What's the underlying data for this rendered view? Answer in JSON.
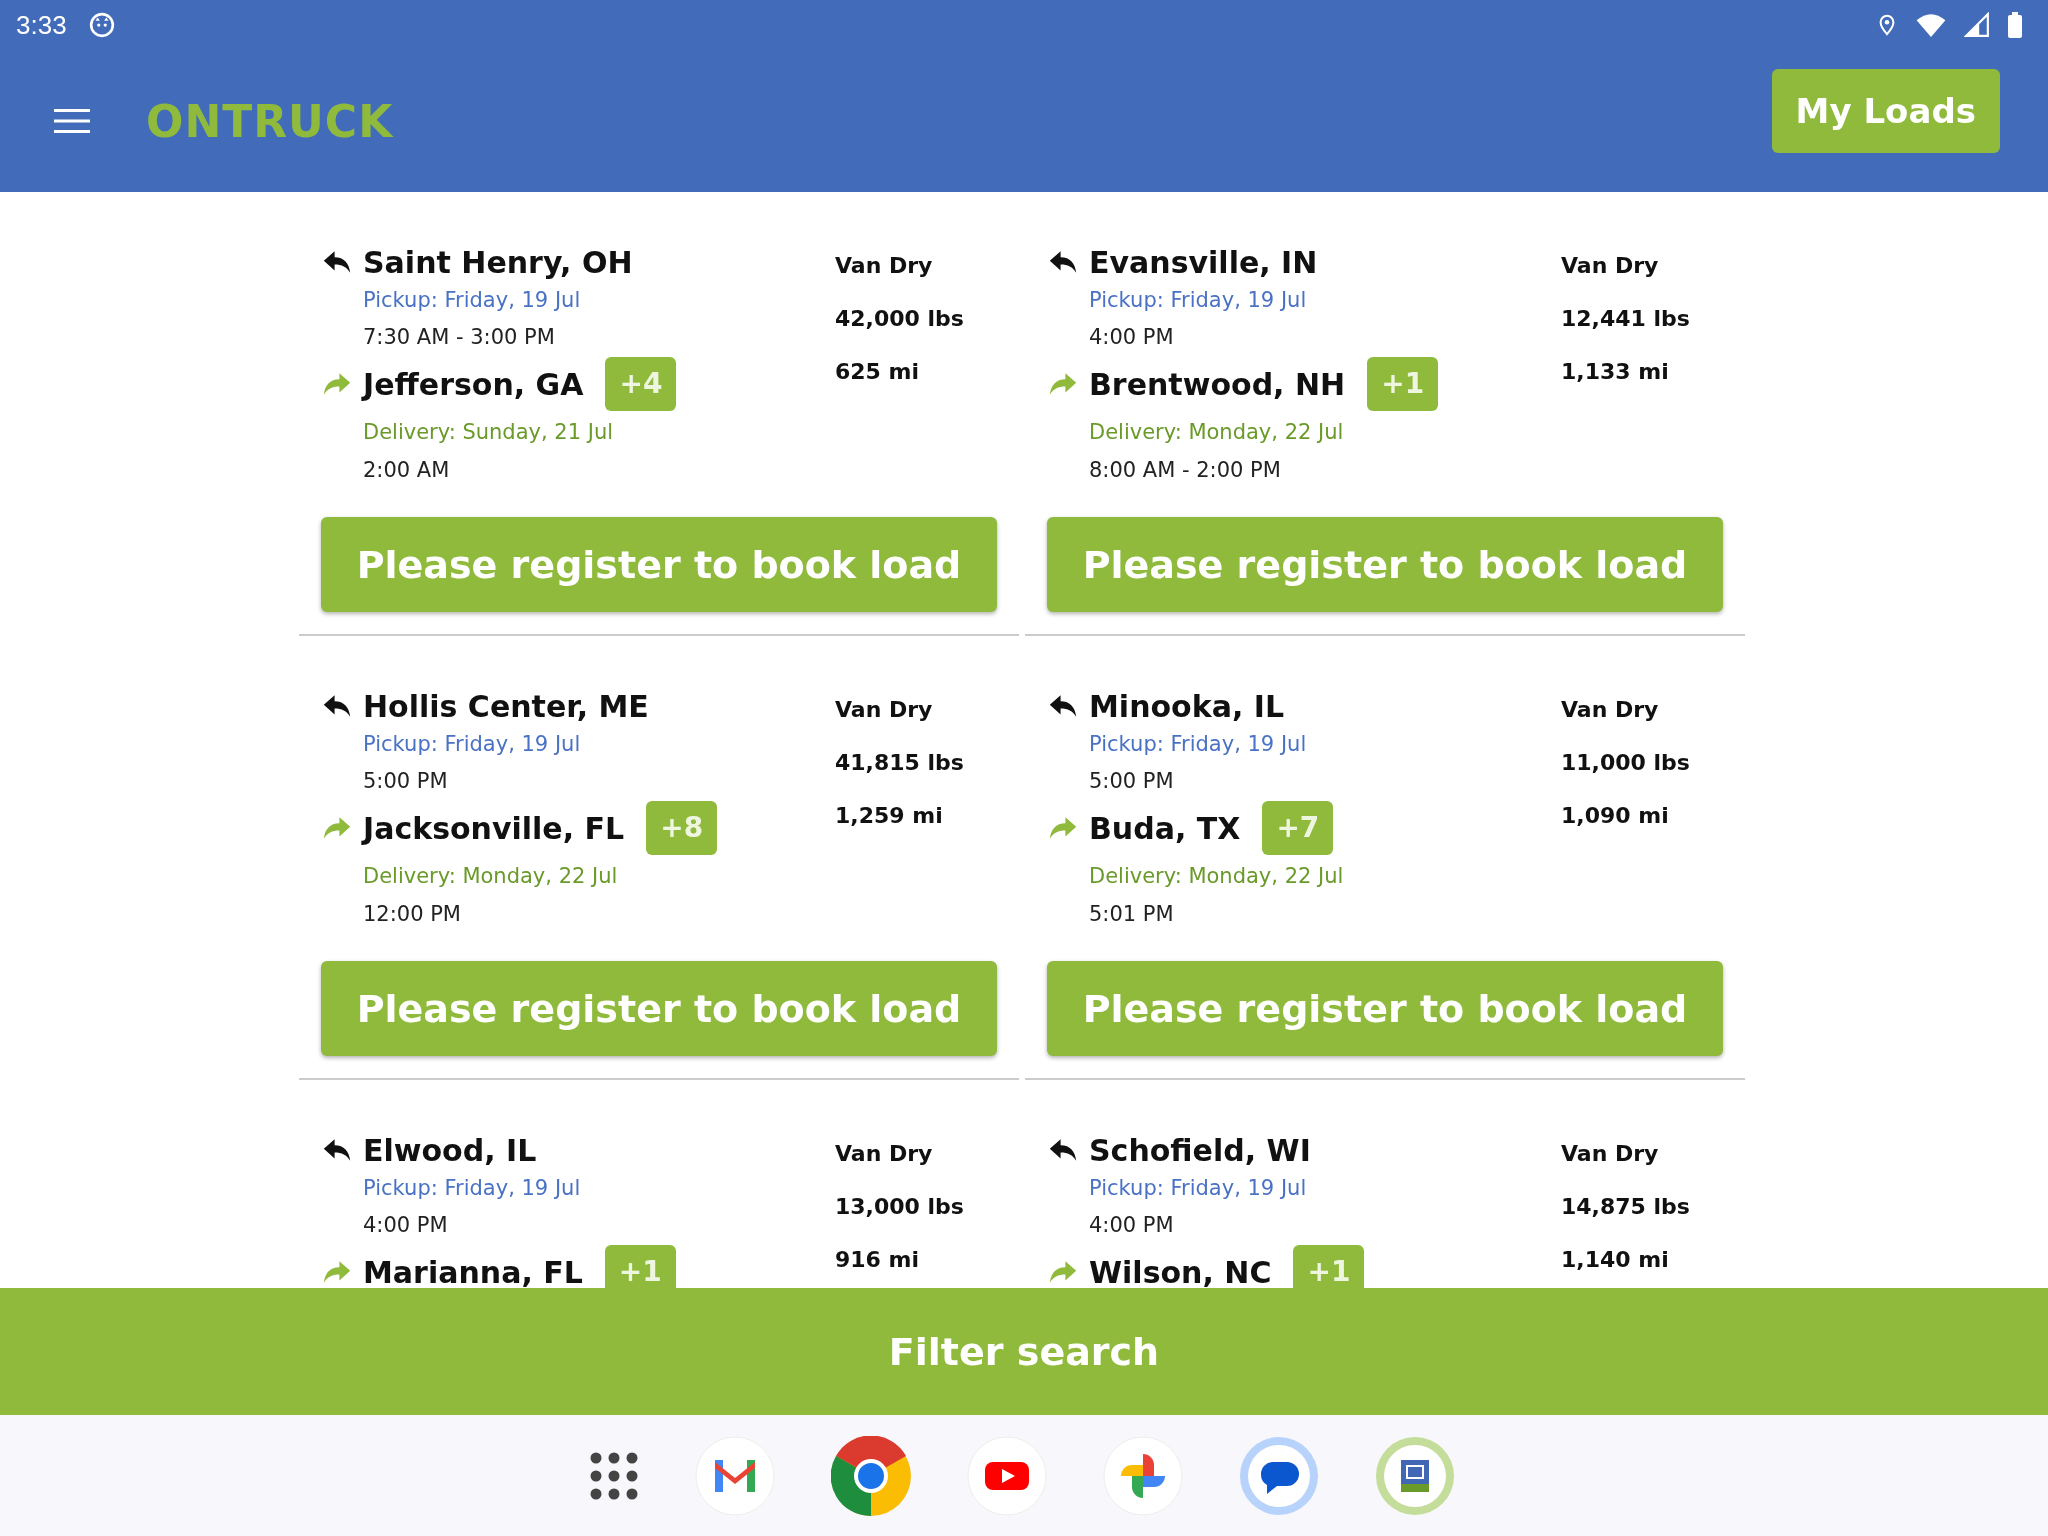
{
  "status_bar": {
    "time": "3:33"
  },
  "toolbar": {
    "brand": "ONTRUCK",
    "my_loads_button": "My Loads"
  },
  "loads": [
    {
      "origin": "Saint Henry, OH",
      "pickup": "Pickup: Friday, 19 Jul",
      "pickup_time": "7:30 AM - 3:00 PM",
      "destination": "Jefferson, GA",
      "extra_stops": "+4",
      "delivery": "Delivery: Sunday, 21 Jul",
      "delivery_time": "2:00 AM",
      "equipment": "Van Dry",
      "weight": "42,000 lbs",
      "distance": "625 mi",
      "button": "Please register to book load"
    },
    {
      "origin": "Evansville, IN",
      "pickup": "Pickup: Friday, 19 Jul",
      "pickup_time": "4:00 PM",
      "destination": "Brentwood, NH",
      "extra_stops": "+1",
      "delivery": "Delivery: Monday, 22 Jul",
      "delivery_time": "8:00 AM - 2:00 PM",
      "equipment": "Van Dry",
      "weight": "12,441 lbs",
      "distance": "1,133 mi",
      "button": "Please register to book load"
    },
    {
      "origin": "Hollis Center, ME",
      "pickup": "Pickup: Friday, 19 Jul",
      "pickup_time": "5:00 PM",
      "destination": "Jacksonville, FL",
      "extra_stops": "+8",
      "delivery": "Delivery: Monday, 22 Jul",
      "delivery_time": "12:00 PM",
      "equipment": "Van Dry",
      "weight": "41,815 lbs",
      "distance": "1,259 mi",
      "button": "Please register to book load"
    },
    {
      "origin": "Minooka, IL",
      "pickup": "Pickup: Friday, 19 Jul",
      "pickup_time": "5:00 PM",
      "destination": "Buda, TX",
      "extra_stops": "+7",
      "delivery": "Delivery: Monday, 22 Jul",
      "delivery_time": "5:01 PM",
      "equipment": "Van Dry",
      "weight": "11,000 lbs",
      "distance": "1,090 mi",
      "button": "Please register to book load"
    },
    {
      "origin": "Elwood, IL",
      "pickup": "Pickup: Friday, 19 Jul",
      "pickup_time": "4:00 PM",
      "destination": "Marianna, FL",
      "extra_stops": "+1",
      "equipment": "Van Dry",
      "weight": "13,000 lbs",
      "distance": "916 mi"
    },
    {
      "origin": "Schofield, WI",
      "pickup": "Pickup: Friday, 19 Jul",
      "pickup_time": "4:00 PM",
      "destination": "Wilson, NC",
      "extra_stops": "+1",
      "equipment": "Van Dry",
      "weight": "14,875 lbs",
      "distance": "1,140 mi"
    }
  ],
  "filter_button": "Filter search"
}
